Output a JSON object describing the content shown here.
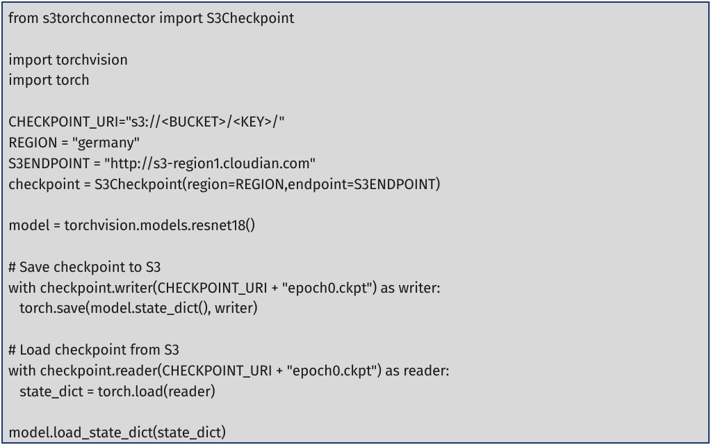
{
  "code": {
    "line1": "from s3torchconnector import S3Checkpoint",
    "line2": "",
    "line3": "import torchvision",
    "line4": "import torch",
    "line5": "",
    "line6": "CHECKPOINT_URI=\"s3://<BUCKET>/<KEY>/\"",
    "line7": "REGION = \"germany\"",
    "line8": "S3ENDPOINT = \"http://s3-region1.cloudian.com\"",
    "line9": "checkpoint = S3Checkpoint(region=REGION,endpoint=S3ENDPOINT)",
    "line10": "",
    "line11": "model = torchvision.models.resnet18()",
    "line12": "",
    "line13": "# Save checkpoint to S3",
    "line14": "with checkpoint.writer(CHECKPOINT_URI + \"epoch0.ckpt\") as writer:",
    "line15": "   torch.save(model.state_dict(), writer)",
    "line16": "",
    "line17": "# Load checkpoint from S3",
    "line18": "with checkpoint.reader(CHECKPOINT_URI + \"epoch0.ckpt\") as reader:",
    "line19": "   state_dict = torch.load(reader)",
    "line20": "",
    "line21": "model.load_state_dict(state_dict)"
  }
}
